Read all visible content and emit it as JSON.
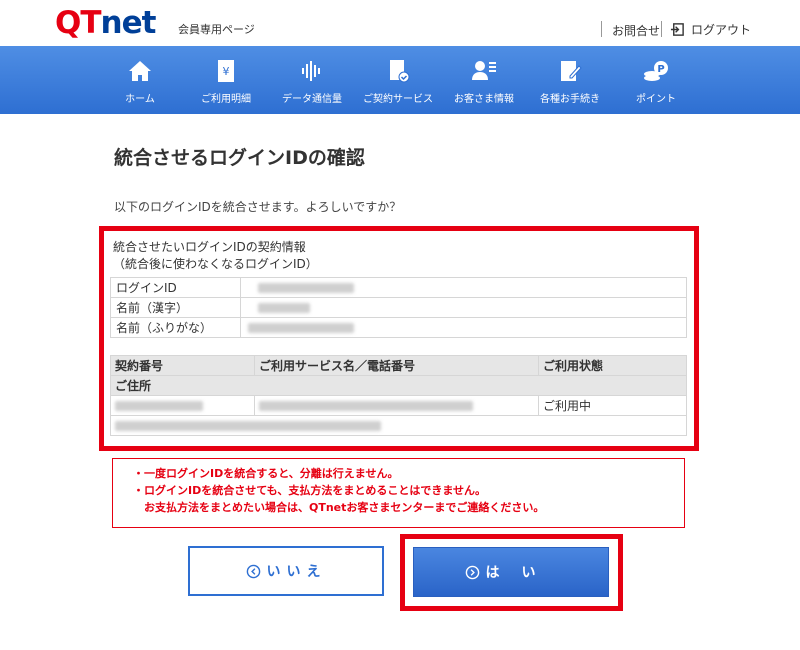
{
  "header": {
    "logo": {
      "q": "Q",
      "t": "T",
      "net": "net"
    },
    "subtitle": "会員専用ページ",
    "contact": "お問合せ",
    "logout": "ログアウト"
  },
  "nav": [
    {
      "label": "ホーム",
      "icon": "home-icon"
    },
    {
      "label": "ご利用明細",
      "icon": "bill-icon"
    },
    {
      "label": "データ通信量",
      "icon": "data-usage-icon"
    },
    {
      "label": "ご契約サービス",
      "icon": "contract-icon"
    },
    {
      "label": "お客さま情報",
      "icon": "user-icon"
    },
    {
      "label": "各種お手続き",
      "icon": "procedure-icon"
    },
    {
      "label": "ポイント",
      "icon": "point-icon"
    }
  ],
  "main": {
    "title": "統合させるログインIDの確認",
    "intro": "以下のログインIDを統合させます。よろしいですか？",
    "section_title_1": "統合させたいログインIDの契約情報",
    "section_title_2": "（統合後に使わなくなるログインID）",
    "info_rows": [
      {
        "key": "ログインID"
      },
      {
        "key": "名前（漢字）"
      },
      {
        "key": "名前（ふりがな）"
      }
    ],
    "svc_headers": {
      "contract_no": "契約番号",
      "service": "ご利用サービス名／電話番号",
      "status": "ご利用状態",
      "address": "ご住所"
    },
    "svc_row": {
      "status": "ご利用中"
    }
  },
  "warning": {
    "line1": "・一度ログインIDを統合すると、分離は行えません。",
    "line2": "・ログインIDを統合させても、支払方法をまとめることはできません。",
    "line3": "　お支払方法をまとめたい場合は、QTnetお客さまセンターまでご連絡ください。"
  },
  "buttons": {
    "no": "いいえ",
    "yes": "はい"
  },
  "colors": {
    "brand_red": "#e60012",
    "brand_blue": "#2e6fd2",
    "highlight": "#e60012"
  }
}
